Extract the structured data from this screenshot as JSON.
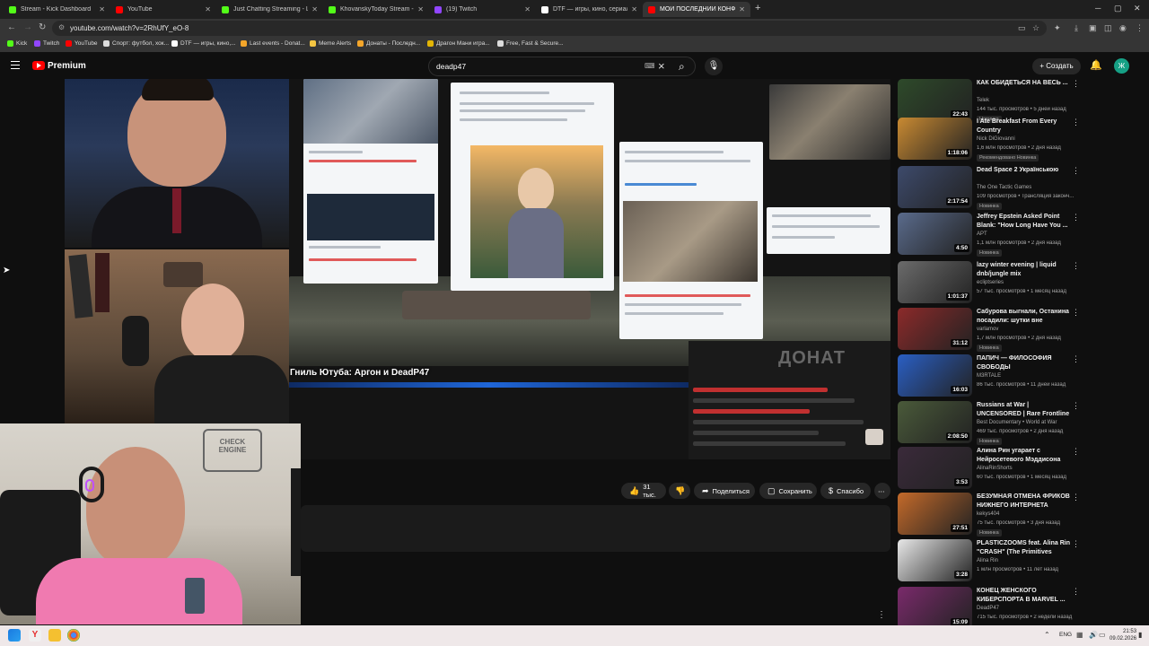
{
  "browser": {
    "tabs": [
      {
        "label": "Stream - Kick Dashboard",
        "color": "#53fc18",
        "active": false
      },
      {
        "label": "YouTube",
        "color": "#ff0000",
        "active": false
      },
      {
        "label": "Just Chatting Streaming - Live S",
        "color": "#53fc18",
        "active": false
      },
      {
        "label": "KhovanskyToday Stream - Watc",
        "color": "#53fc18",
        "active": false
      },
      {
        "label": "(19) Twitch",
        "color": "#9146ff",
        "active": false
      },
      {
        "label": "DTF — игры, кино, сериалы, р",
        "color": "#ffffff",
        "active": false
      },
      {
        "label": "МОЙ ПОСЛЕДНИЙ КОНФЛИК",
        "color": "#ff0000",
        "active": true
      }
    ],
    "new_tab": "+",
    "url": "youtube.com/watch?v=2RhUfY_eO-8",
    "bookmarks": [
      {
        "label": "Kick",
        "color": "#53fc18"
      },
      {
        "label": "Twitch",
        "color": "#9146ff"
      },
      {
        "label": "YouTube",
        "color": "#ff0000"
      },
      {
        "label": "Спорт: футбол, хок...",
        "color": "#dddddd"
      },
      {
        "label": "DTF — игры, кино,...",
        "color": "#ffffff"
      },
      {
        "label": "Last events - Donat...",
        "color": "#f4a62a"
      },
      {
        "label": "Meme Alerts",
        "color": "#f4c542"
      },
      {
        "label": "Донаты - Последн...",
        "color": "#f4a62a"
      },
      {
        "label": "Драгон Мани игра...",
        "color": "#e3b505"
      },
      {
        "label": "Free, Fast & Secure...",
        "color": "#dddddd"
      }
    ]
  },
  "youtube": {
    "brand": "Premium",
    "search_value": "deadp47",
    "create_label": "Создать",
    "avatar_letter": "Ж"
  },
  "video": {
    "overlay_title": "Гниль Ютуба: Аргон и DeadP47",
    "donate_text": "ДОНАТ"
  },
  "actions": {
    "likes": "31 тыс.",
    "share": "Поделиться",
    "save": "Сохранить",
    "thanks": "Спасибо"
  },
  "related": [
    {
      "title": "КАК ОБИДЕТЬСЯ НА ВЕСЬ ...",
      "channel": "Telek",
      "meta": "144 тыс. просмотров • 5 дней назад",
      "badge": "Новинка",
      "duration": "22:43",
      "thumb": "#2e4a2a"
    },
    {
      "title": "I Ate Breakfast From Every Country",
      "channel": "Nick DiGiovanni",
      "meta": "1,6 млн просмотров • 2 дня назад",
      "badge": "Рекомендовано  Новинка",
      "duration": "1:18:06",
      "thumb": "#c98a32"
    },
    {
      "title": "Dead Space  2 Українською",
      "channel": "The One Tactic Games",
      "meta": "109 просмотров • Трансляция законч...",
      "badge": "Новинка",
      "duration": "2:17:54",
      "thumb": "#3d4a6b"
    },
    {
      "title": "Jeffrey Epstein Asked Point Blank: \"How Long Have You ...",
      "channel": "APT",
      "meta": "1,1 млн просмотров • 2 дня назад",
      "badge": "Новинка",
      "duration": "4:50",
      "thumb": "#5a6b8c"
    },
    {
      "title": "lazy winter evening | liquid dnb/jungle mix",
      "channel": "ecliptseries",
      "meta": "57 тыс. просмотров • 1 месяц назад",
      "badge": "",
      "duration": "1:01:37",
      "thumb": "#6b6b6b"
    },
    {
      "title": "Сабурова выгнали, Останина посадили: шутки вне закона...",
      "channel": "varlamov",
      "meta": "1,7 млн просмотров • 2 дня назад",
      "badge": "Новинка",
      "duration": "31:12",
      "thumb": "#8c2a2a"
    },
    {
      "title": "ПАПИЧ — ФИЛОСОФИЯ СВОБОДЫ",
      "channel": "M3RTALE",
      "meta": "86 тыс. просмотров • 11 дней назад",
      "badge": "",
      "duration": "16:03",
      "thumb": "#2a5fc4"
    },
    {
      "title": "Russians at War | UNCENSORED | Rare Frontline Access ...",
      "channel": "Best Documentary • World at War",
      "meta": "469 тыс. просмотров • 2 дня назад",
      "badge": "Новинка",
      "duration": "2:08:50",
      "thumb": "#4a5a3a"
    },
    {
      "title": "Алина Рин угарает с Нейросетевого Мэддисона",
      "channel": "AlinaRinShorts",
      "meta": "60 тыс. просмотров • 1 месяц назад",
      "badge": "",
      "duration": "3:53",
      "thumb": "#3a2a3a"
    },
    {
      "title": "БЕЗУМНАЯ ОТМЕНА ФРИКОВ НИЖНЕГО ИНТЕРНЕТА",
      "channel": "kekys404",
      "meta": "75 тыс. просмотров • 3 дня назад",
      "badge": "Новинка",
      "duration": "27:51",
      "thumb": "#c46a2a"
    },
    {
      "title": "PLASTICZOOMS feat. Alina Rin \"CRASH\" (The Primitives Cover)",
      "channel": "Alina Rin",
      "meta": "1 млн просмотров • 11 лет назад",
      "badge": "",
      "duration": "3:28",
      "thumb": "#e8e8e8"
    },
    {
      "title": "КОНЕЦ ЖЕНСКОГО КИБЕРСПОРТА В MARVEL ...",
      "channel": "DeadP47",
      "meta": "715 тыс. просмотров • 2 недели назад",
      "badge": "",
      "duration": "15:09",
      "thumb": "#7a2a6b"
    }
  ],
  "taskbar": {
    "lang": "ENG",
    "time": "21:53",
    "date": "09.02.2026"
  }
}
